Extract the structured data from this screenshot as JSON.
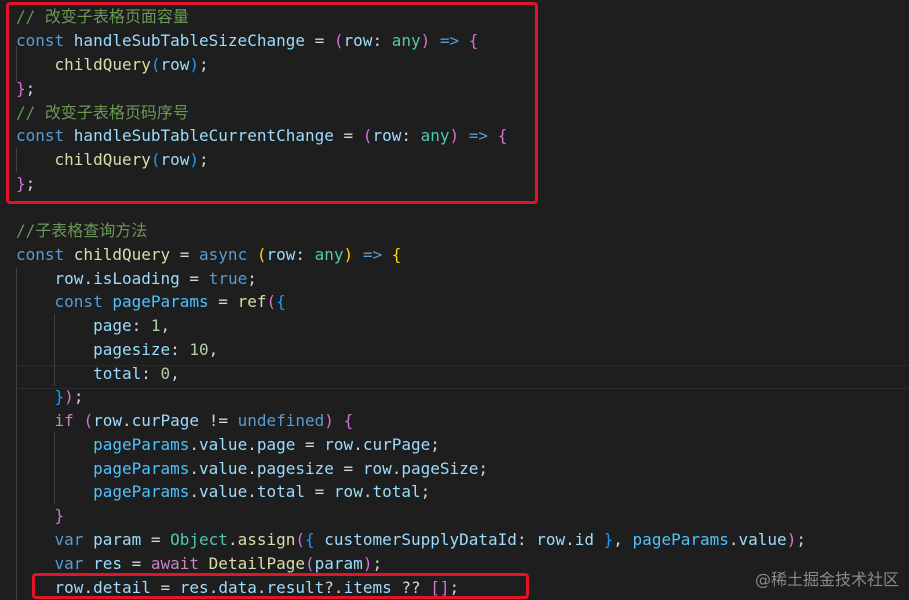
{
  "colors": {
    "background": "#1e1e1e",
    "highlight_box": "#e0152a"
  },
  "lines": [
    {
      "tokens": [
        {
          "t": "// 改变子表格页面容量",
          "c": "#6a9955"
        }
      ]
    },
    {
      "tokens": [
        {
          "t": "const ",
          "c": "#569cd6"
        },
        {
          "t": "handleSubTableSizeChange",
          "c": "#9cdcfe"
        },
        {
          "t": " = ",
          "c": "#d4d4d4"
        },
        {
          "t": "(",
          "c": "#da70d6"
        },
        {
          "t": "row",
          "c": "#9cdcfe"
        },
        {
          "t": ": ",
          "c": "#d4d4d4"
        },
        {
          "t": "any",
          "c": "#4ec9b0"
        },
        {
          "t": ") ",
          "c": "#da70d6"
        },
        {
          "t": "=> ",
          "c": "#569cd6"
        },
        {
          "t": "{",
          "c": "#da70d6"
        }
      ]
    },
    {
      "tokens": [
        {
          "t": "    ",
          "c": "#d4d4d4"
        },
        {
          "t": "childQuery",
          "c": "#dcdcaa"
        },
        {
          "t": "(",
          "c": "#179fff"
        },
        {
          "t": "row",
          "c": "#9cdcfe"
        },
        {
          "t": ")",
          "c": "#179fff"
        },
        {
          "t": ";",
          "c": "#d4d4d4"
        }
      ]
    },
    {
      "tokens": [
        {
          "t": "}",
          "c": "#da70d6"
        },
        {
          "t": ";",
          "c": "#d4d4d4"
        }
      ]
    },
    {
      "tokens": [
        {
          "t": "// 改变子表格页码序号",
          "c": "#6a9955"
        }
      ]
    },
    {
      "tokens": [
        {
          "t": "const ",
          "c": "#569cd6"
        },
        {
          "t": "handleSubTableCurrentChange",
          "c": "#9cdcfe"
        },
        {
          "t": " = ",
          "c": "#d4d4d4"
        },
        {
          "t": "(",
          "c": "#da70d6"
        },
        {
          "t": "row",
          "c": "#9cdcfe"
        },
        {
          "t": ": ",
          "c": "#d4d4d4"
        },
        {
          "t": "any",
          "c": "#4ec9b0"
        },
        {
          "t": ") ",
          "c": "#da70d6"
        },
        {
          "t": "=> ",
          "c": "#569cd6"
        },
        {
          "t": "{",
          "c": "#da70d6"
        }
      ]
    },
    {
      "tokens": [
        {
          "t": "    ",
          "c": "#d4d4d4"
        },
        {
          "t": "childQuery",
          "c": "#dcdcaa"
        },
        {
          "t": "(",
          "c": "#179fff"
        },
        {
          "t": "row",
          "c": "#9cdcfe"
        },
        {
          "t": ")",
          "c": "#179fff"
        },
        {
          "t": ";",
          "c": "#d4d4d4"
        }
      ]
    },
    {
      "tokens": [
        {
          "t": "}",
          "c": "#da70d6"
        },
        {
          "t": ";",
          "c": "#d4d4d4"
        }
      ]
    },
    {
      "tokens": []
    },
    {
      "tokens": [
        {
          "t": "//子表格查询方法",
          "c": "#6a9955"
        }
      ]
    },
    {
      "tokens": [
        {
          "t": "const ",
          "c": "#569cd6"
        },
        {
          "t": "childQuery",
          "c": "#dcdcaa"
        },
        {
          "t": " = ",
          "c": "#d4d4d4"
        },
        {
          "t": "async ",
          "c": "#569cd6"
        },
        {
          "t": "(",
          "c": "#ffd700"
        },
        {
          "t": "row",
          "c": "#9cdcfe"
        },
        {
          "t": ": ",
          "c": "#d4d4d4"
        },
        {
          "t": "any",
          "c": "#4ec9b0"
        },
        {
          "t": ") ",
          "c": "#ffd700"
        },
        {
          "t": "=> ",
          "c": "#569cd6"
        },
        {
          "t": "{",
          "c": "#ffd700"
        }
      ]
    },
    {
      "tokens": [
        {
          "t": "    ",
          "c": "#d4d4d4"
        },
        {
          "t": "row",
          "c": "#9cdcfe"
        },
        {
          "t": ".",
          "c": "#d4d4d4"
        },
        {
          "t": "isLoading",
          "c": "#9cdcfe"
        },
        {
          "t": " = ",
          "c": "#d4d4d4"
        },
        {
          "t": "true",
          "c": "#569cd6"
        },
        {
          "t": ";",
          "c": "#d4d4d4"
        }
      ]
    },
    {
      "tokens": [
        {
          "t": "    ",
          "c": "#d4d4d4"
        },
        {
          "t": "const ",
          "c": "#569cd6"
        },
        {
          "t": "pageParams",
          "c": "#4fc1ff"
        },
        {
          "t": " = ",
          "c": "#d4d4d4"
        },
        {
          "t": "ref",
          "c": "#dcdcaa"
        },
        {
          "t": "(",
          "c": "#da70d6"
        },
        {
          "t": "{",
          "c": "#179fff"
        }
      ]
    },
    {
      "tokens": [
        {
          "t": "        ",
          "c": "#d4d4d4"
        },
        {
          "t": "page",
          "c": "#9cdcfe"
        },
        {
          "t": ": ",
          "c": "#d4d4d4"
        },
        {
          "t": "1",
          "c": "#b5cea8"
        },
        {
          "t": ",",
          "c": "#d4d4d4"
        }
      ]
    },
    {
      "tokens": [
        {
          "t": "        ",
          "c": "#d4d4d4"
        },
        {
          "t": "pagesize",
          "c": "#9cdcfe"
        },
        {
          "t": ": ",
          "c": "#d4d4d4"
        },
        {
          "t": "10",
          "c": "#b5cea8"
        },
        {
          "t": ",",
          "c": "#d4d4d4"
        }
      ]
    },
    {
      "tokens": [
        {
          "t": "        ",
          "c": "#d4d4d4"
        },
        {
          "t": "total",
          "c": "#9cdcfe"
        },
        {
          "t": ": ",
          "c": "#d4d4d4"
        },
        {
          "t": "0",
          "c": "#b5cea8"
        },
        {
          "t": ",",
          "c": "#d4d4d4"
        }
      ]
    },
    {
      "tokens": [
        {
          "t": "    ",
          "c": "#d4d4d4"
        },
        {
          "t": "}",
          "c": "#179fff"
        },
        {
          "t": ")",
          "c": "#da70d6"
        },
        {
          "t": ";",
          "c": "#d4d4d4"
        }
      ]
    },
    {
      "tokens": [
        {
          "t": "    ",
          "c": "#d4d4d4"
        },
        {
          "t": "if ",
          "c": "#c586c0"
        },
        {
          "t": "(",
          "c": "#da70d6"
        },
        {
          "t": "row",
          "c": "#9cdcfe"
        },
        {
          "t": ".",
          "c": "#d4d4d4"
        },
        {
          "t": "curPage",
          "c": "#9cdcfe"
        },
        {
          "t": " != ",
          "c": "#d4d4d4"
        },
        {
          "t": "undefined",
          "c": "#569cd6"
        },
        {
          "t": ") ",
          "c": "#da70d6"
        },
        {
          "t": "{",
          "c": "#da70d6"
        }
      ]
    },
    {
      "tokens": [
        {
          "t": "        ",
          "c": "#d4d4d4"
        },
        {
          "t": "pageParams",
          "c": "#4fc1ff"
        },
        {
          "t": ".",
          "c": "#d4d4d4"
        },
        {
          "t": "value",
          "c": "#9cdcfe"
        },
        {
          "t": ".",
          "c": "#d4d4d4"
        },
        {
          "t": "page",
          "c": "#9cdcfe"
        },
        {
          "t": " = ",
          "c": "#d4d4d4"
        },
        {
          "t": "row",
          "c": "#9cdcfe"
        },
        {
          "t": ".",
          "c": "#d4d4d4"
        },
        {
          "t": "curPage",
          "c": "#9cdcfe"
        },
        {
          "t": ";",
          "c": "#d4d4d4"
        }
      ]
    },
    {
      "tokens": [
        {
          "t": "        ",
          "c": "#d4d4d4"
        },
        {
          "t": "pageParams",
          "c": "#4fc1ff"
        },
        {
          "t": ".",
          "c": "#d4d4d4"
        },
        {
          "t": "value",
          "c": "#9cdcfe"
        },
        {
          "t": ".",
          "c": "#d4d4d4"
        },
        {
          "t": "pagesize",
          "c": "#9cdcfe"
        },
        {
          "t": " = ",
          "c": "#d4d4d4"
        },
        {
          "t": "row",
          "c": "#9cdcfe"
        },
        {
          "t": ".",
          "c": "#d4d4d4"
        },
        {
          "t": "pageSize",
          "c": "#9cdcfe"
        },
        {
          "t": ";",
          "c": "#d4d4d4"
        }
      ]
    },
    {
      "tokens": [
        {
          "t": "        ",
          "c": "#d4d4d4"
        },
        {
          "t": "pageParams",
          "c": "#4fc1ff"
        },
        {
          "t": ".",
          "c": "#d4d4d4"
        },
        {
          "t": "value",
          "c": "#9cdcfe"
        },
        {
          "t": ".",
          "c": "#d4d4d4"
        },
        {
          "t": "total",
          "c": "#9cdcfe"
        },
        {
          "t": " = ",
          "c": "#d4d4d4"
        },
        {
          "t": "row",
          "c": "#9cdcfe"
        },
        {
          "t": ".",
          "c": "#d4d4d4"
        },
        {
          "t": "total",
          "c": "#9cdcfe"
        },
        {
          "t": ";",
          "c": "#d4d4d4"
        }
      ]
    },
    {
      "tokens": [
        {
          "t": "    ",
          "c": "#d4d4d4"
        },
        {
          "t": "}",
          "c": "#da70d6"
        }
      ]
    },
    {
      "tokens": [
        {
          "t": "    ",
          "c": "#d4d4d4"
        },
        {
          "t": "var ",
          "c": "#569cd6"
        },
        {
          "t": "param",
          "c": "#9cdcfe"
        },
        {
          "t": " = ",
          "c": "#d4d4d4"
        },
        {
          "t": "Object",
          "c": "#4ec9b0"
        },
        {
          "t": ".",
          "c": "#d4d4d4"
        },
        {
          "t": "assign",
          "c": "#dcdcaa"
        },
        {
          "t": "(",
          "c": "#da70d6"
        },
        {
          "t": "{ ",
          "c": "#179fff"
        },
        {
          "t": "customerSupplyDataId",
          "c": "#9cdcfe"
        },
        {
          "t": ": ",
          "c": "#d4d4d4"
        },
        {
          "t": "row",
          "c": "#9cdcfe"
        },
        {
          "t": ".",
          "c": "#d4d4d4"
        },
        {
          "t": "id",
          "c": "#9cdcfe"
        },
        {
          "t": " }",
          "c": "#179fff"
        },
        {
          "t": ", ",
          "c": "#d4d4d4"
        },
        {
          "t": "pageParams",
          "c": "#4fc1ff"
        },
        {
          "t": ".",
          "c": "#d4d4d4"
        },
        {
          "t": "value",
          "c": "#9cdcfe"
        },
        {
          "t": ")",
          "c": "#da70d6"
        },
        {
          "t": ";",
          "c": "#d4d4d4"
        }
      ]
    },
    {
      "tokens": [
        {
          "t": "    ",
          "c": "#d4d4d4"
        },
        {
          "t": "var ",
          "c": "#569cd6"
        },
        {
          "t": "res",
          "c": "#9cdcfe"
        },
        {
          "t": " = ",
          "c": "#d4d4d4"
        },
        {
          "t": "await ",
          "c": "#c586c0"
        },
        {
          "t": "DetailPage",
          "c": "#dcdcaa"
        },
        {
          "t": "(",
          "c": "#da70d6"
        },
        {
          "t": "param",
          "c": "#9cdcfe"
        },
        {
          "t": ")",
          "c": "#da70d6"
        },
        {
          "t": ";",
          "c": "#d4d4d4"
        }
      ]
    },
    {
      "tokens": [
        {
          "t": "    ",
          "c": "#d4d4d4"
        },
        {
          "t": "row",
          "c": "#9cdcfe"
        },
        {
          "t": ".",
          "c": "#d4d4d4"
        },
        {
          "t": "detail",
          "c": "#9cdcfe"
        },
        {
          "t": " = ",
          "c": "#d4d4d4"
        },
        {
          "t": "res",
          "c": "#9cdcfe"
        },
        {
          "t": ".",
          "c": "#d4d4d4"
        },
        {
          "t": "data",
          "c": "#9cdcfe"
        },
        {
          "t": ".",
          "c": "#d4d4d4"
        },
        {
          "t": "result",
          "c": "#9cdcfe"
        },
        {
          "t": "?.",
          "c": "#d4d4d4"
        },
        {
          "t": "items",
          "c": "#9cdcfe"
        },
        {
          "t": " ?? ",
          "c": "#d4d4d4"
        },
        {
          "t": "[]",
          "c": "#da70d6"
        },
        {
          "t": ";",
          "c": "#d4d4d4"
        }
      ]
    }
  ],
  "watermark": "@稀土掘金技术社区"
}
